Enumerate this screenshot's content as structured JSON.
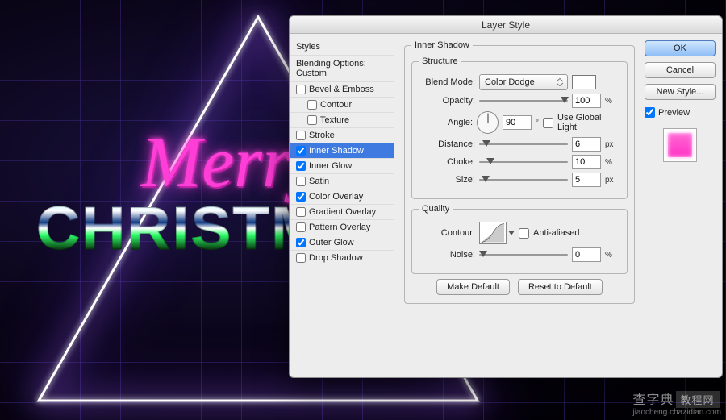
{
  "canvas": {
    "script_text": "Merry",
    "block_text": "CHRISTM"
  },
  "dialog": {
    "title": "Layer Style",
    "styles_header": "Styles",
    "blending_header": "Blending Options: Custom",
    "effects": [
      {
        "label": "Bevel & Emboss",
        "checked": false,
        "selected": false,
        "sub": false
      },
      {
        "label": "Contour",
        "checked": false,
        "selected": false,
        "sub": true
      },
      {
        "label": "Texture",
        "checked": false,
        "selected": false,
        "sub": true
      },
      {
        "label": "Stroke",
        "checked": false,
        "selected": false,
        "sub": false
      },
      {
        "label": "Inner Shadow",
        "checked": true,
        "selected": true,
        "sub": false
      },
      {
        "label": "Inner Glow",
        "checked": true,
        "selected": false,
        "sub": false
      },
      {
        "label": "Satin",
        "checked": false,
        "selected": false,
        "sub": false
      },
      {
        "label": "Color Overlay",
        "checked": true,
        "selected": false,
        "sub": false
      },
      {
        "label": "Gradient Overlay",
        "checked": false,
        "selected": false,
        "sub": false
      },
      {
        "label": "Pattern Overlay",
        "checked": false,
        "selected": false,
        "sub": false
      },
      {
        "label": "Outer Glow",
        "checked": true,
        "selected": false,
        "sub": false
      },
      {
        "label": "Drop Shadow",
        "checked": false,
        "selected": false,
        "sub": false
      }
    ],
    "panel_title": "Inner Shadow",
    "structure_title": "Structure",
    "labels": {
      "blend_mode": "Blend Mode:",
      "opacity": "Opacity:",
      "angle": "Angle:",
      "use_global": "Use Global Light",
      "distance": "Distance:",
      "choke": "Choke:",
      "size": "Size:",
      "quality": "Quality",
      "contour": "Contour:",
      "anti_aliased": "Anti-aliased",
      "noise": "Noise:"
    },
    "values": {
      "blend_mode": "Color Dodge",
      "opacity": "100",
      "angle": "90",
      "distance": "6",
      "choke": "10",
      "size": "5",
      "noise": "0",
      "use_global": false,
      "anti_aliased": false
    },
    "units": {
      "pct": "%",
      "px": "px",
      "deg": "°"
    },
    "buttons": {
      "make_default": "Make Default",
      "reset_default": "Reset to Default",
      "ok": "OK",
      "cancel": "Cancel",
      "new_style": "New Style...",
      "preview": "Preview"
    },
    "preview_checked": true
  },
  "watermark": {
    "main": "查字典",
    "tag": "教程网",
    "sub": "jiaocheng.chazidian.com"
  }
}
